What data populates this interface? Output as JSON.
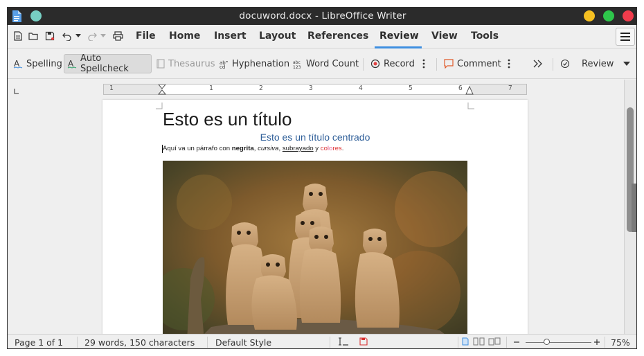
{
  "window": {
    "title": "docuword.docx - LibreOffice Writer",
    "colors": {
      "minimize": "#f6c021",
      "maximize": "#2ec64b",
      "close": "#f03c4c",
      "pin": "#77d0c4",
      "accent": "#3d8ee0"
    }
  },
  "menu": {
    "tabs": [
      {
        "label": "File"
      },
      {
        "label": "Home"
      },
      {
        "label": "Insert"
      },
      {
        "label": "Layout"
      },
      {
        "label": "References"
      },
      {
        "label": "Review",
        "active": true
      },
      {
        "label": "View"
      },
      {
        "label": "Tools"
      }
    ]
  },
  "toolbar": {
    "spelling": "Spelling",
    "auto_spellcheck": "Auto Spellcheck",
    "thesaurus": "Thesaurus",
    "hyphenation": "Hyphenation",
    "word_count": "Word Count",
    "record": "Record",
    "comment": "Comment",
    "review": "Review"
  },
  "ruler": {
    "numbers": [
      "1",
      "1",
      "2",
      "3",
      "4",
      "5",
      "6",
      "7"
    ]
  },
  "document": {
    "heading1": "Esto es un título",
    "heading2": "Esto es un título centrado",
    "paragraph": {
      "intro": "Aquí va un párrafo con ",
      "bold": "negrita",
      "sep1": ", ",
      "italic": "cursiva",
      "sep2": ", ",
      "underline": "subrayado",
      "sep3": " y ",
      "colored_1": "co",
      "colored_2": "lo",
      "colored_3": "res",
      "end": "."
    }
  },
  "statusbar": {
    "page": "Page 1 of 1",
    "words": "29 words, 150 characters",
    "style": "Default Style",
    "zoom": "75%"
  }
}
